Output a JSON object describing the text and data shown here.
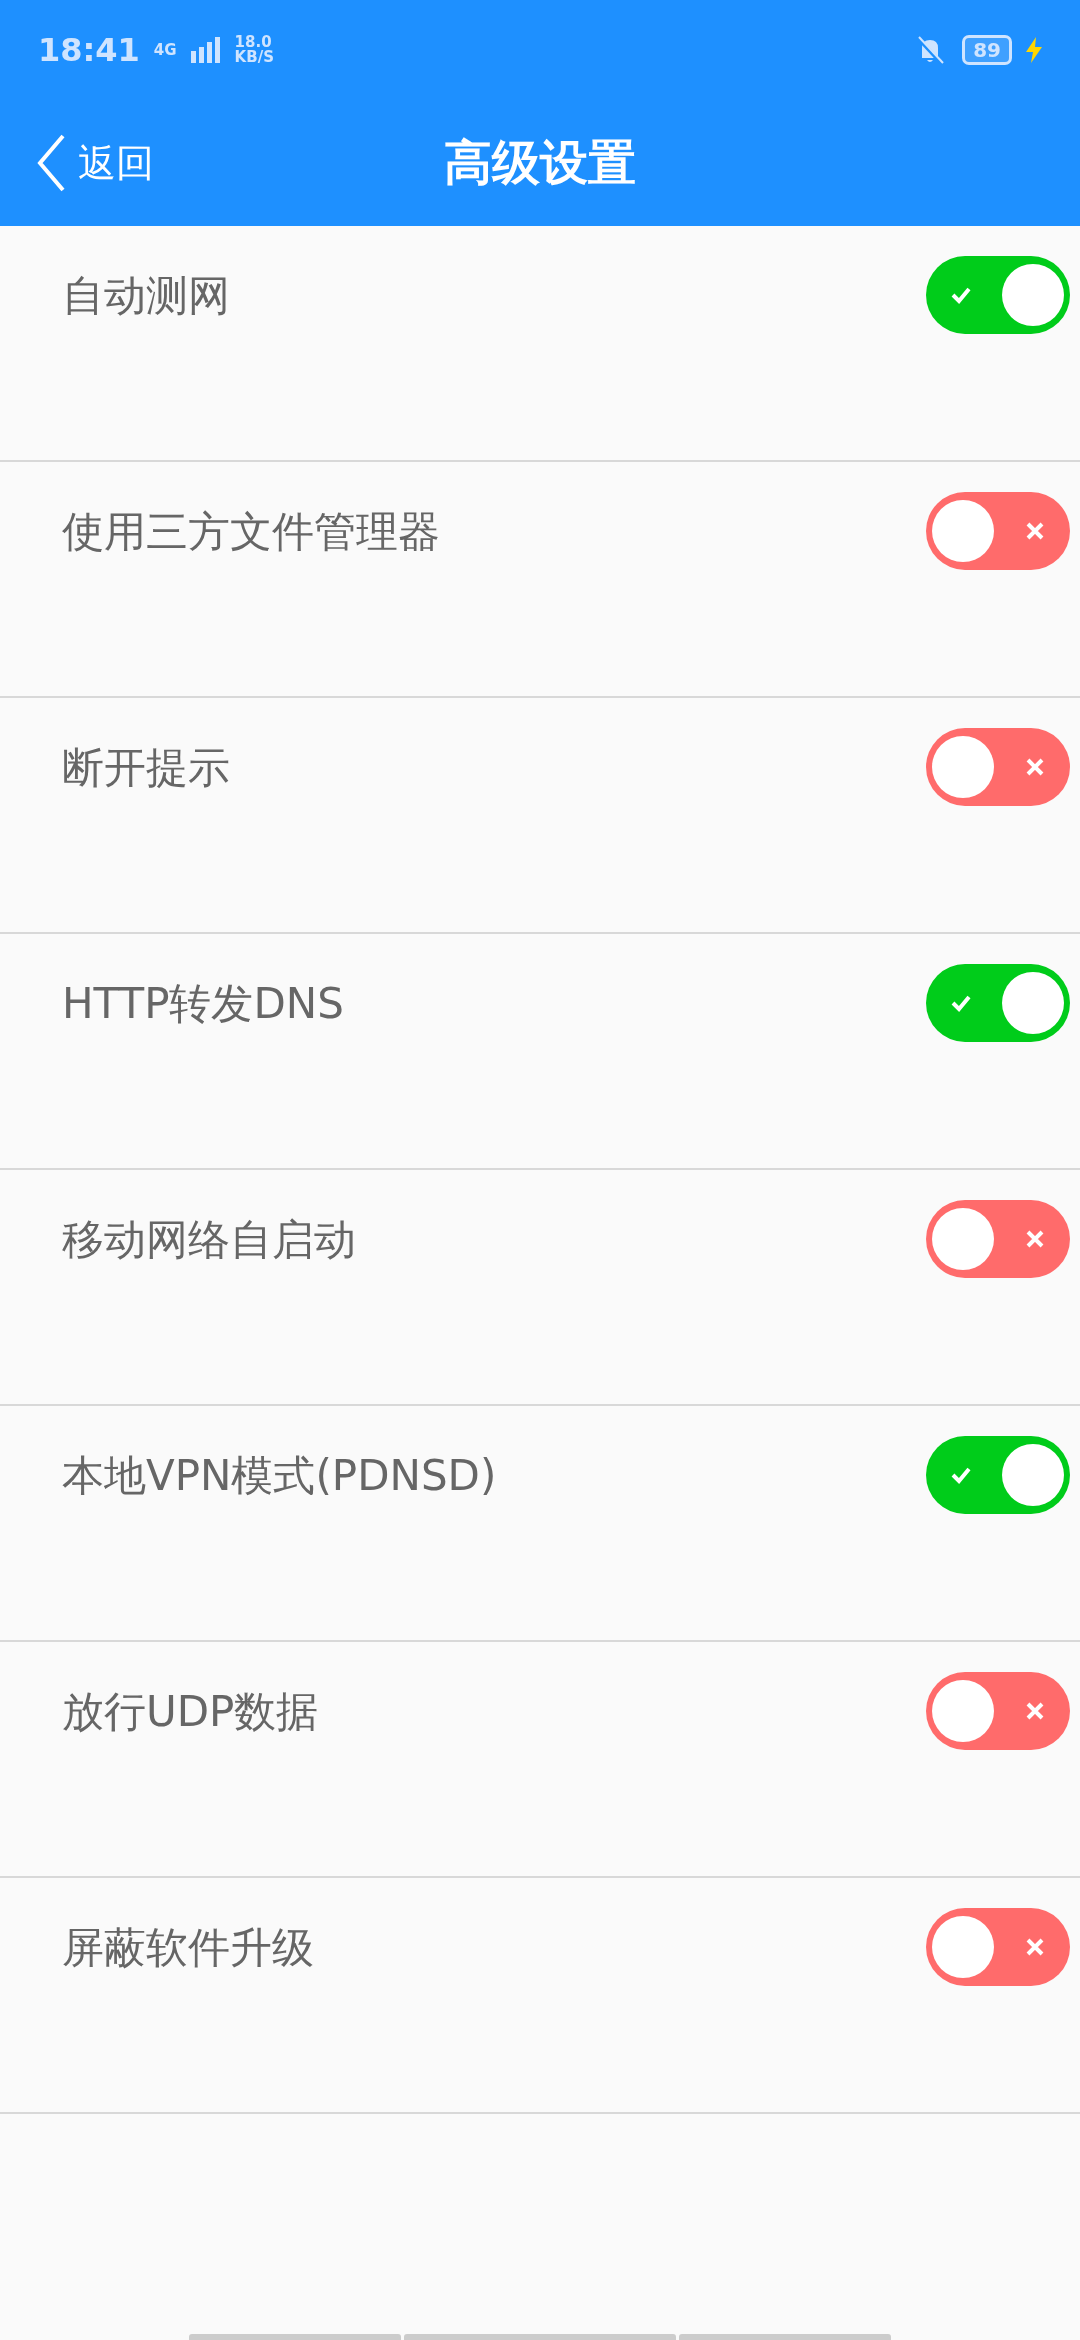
{
  "status_bar": {
    "time": "18:41",
    "network": "4G",
    "speed": "18.0",
    "speed_unit": "KB/S",
    "battery": "89"
  },
  "header": {
    "back": "返回",
    "title": "高级设置"
  },
  "settings": [
    {
      "label": "自动测网",
      "on": true
    },
    {
      "label": "使用三方文件管理器",
      "on": false
    },
    {
      "label": "断开提示",
      "on": false
    },
    {
      "label": "HTTP转发DNS",
      "on": true
    },
    {
      "label": "移动网络自启动",
      "on": false
    },
    {
      "label": "本地VPN模式(PDNSD)",
      "on": true
    },
    {
      "label": "放行UDP数据",
      "on": false
    },
    {
      "label": "屏蔽软件升级",
      "on": false
    }
  ]
}
